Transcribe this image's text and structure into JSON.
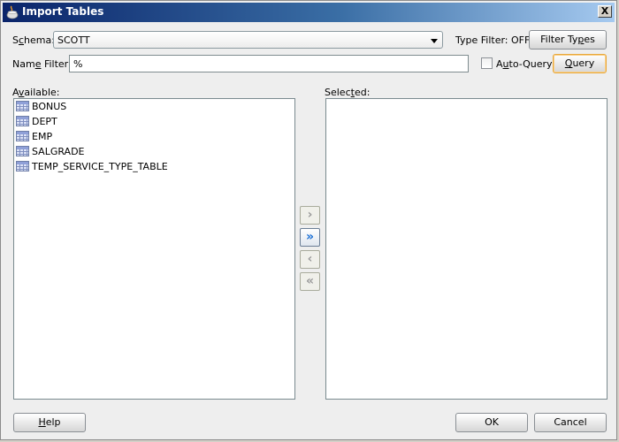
{
  "window": {
    "title": "Import Tables",
    "close_label": "X"
  },
  "schema": {
    "label_pre": "S",
    "label_mnemonic": "c",
    "label_post": "hema:",
    "value": "SCOTT"
  },
  "type_filter": {
    "label": "Type Filter: OFF",
    "button_pre": "Filter Ty",
    "button_mnemonic": "p",
    "button_post": "es"
  },
  "name_filter": {
    "label_pre": "Nam",
    "label_mnemonic": "e",
    "label_post": " Filter:",
    "value": "%"
  },
  "auto_query": {
    "label_pre": "A",
    "label_mnemonic": "u",
    "label_post": "to-Query",
    "checked": false
  },
  "query_button": {
    "mnemonic": "Q",
    "rest": "uery"
  },
  "available": {
    "label_pre": "A",
    "label_mnemonic": "v",
    "label_post": "ailable:",
    "items": [
      "BONUS",
      "DEPT",
      "EMP",
      "SALGRADE",
      "TEMP_SERVICE_TYPE_TABLE"
    ]
  },
  "selected": {
    "label_pre": "Selec",
    "label_mnemonic": "t",
    "label_post": "ed:",
    "items": []
  },
  "shuttle": {
    "move_one": "›",
    "move_all": "»",
    "remove_one": "‹",
    "remove_all": "«"
  },
  "footer": {
    "help_mnemonic": "H",
    "help_rest": "elp",
    "ok_label": "OK",
    "cancel_label": "Cancel"
  }
}
